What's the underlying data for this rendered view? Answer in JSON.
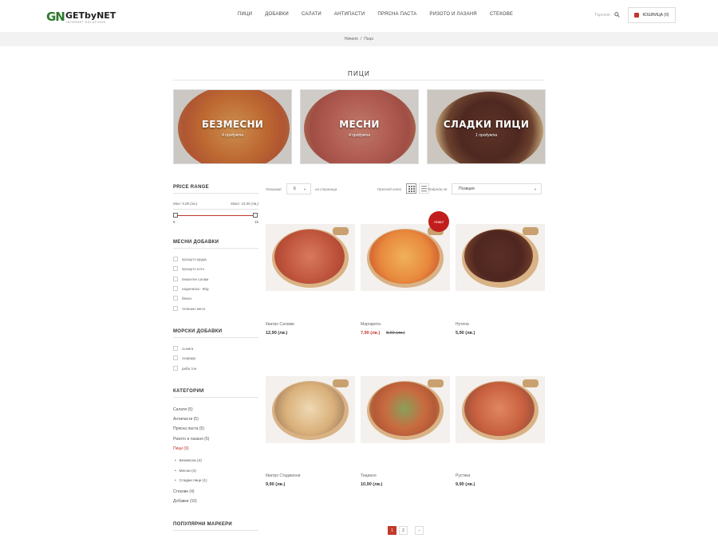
{
  "header": {
    "logo_mark": "GN",
    "logo_text": "GETbyNET",
    "logo_sub": "INTERNET SOLUTIONS",
    "nav": [
      "ПИЦИ",
      "ДОБАВКИ",
      "САЛАТИ",
      "АНТИПАСТИ",
      "ПРЯСНА ПАСТА",
      "РИЗОТО И ЛАЗАНЯ",
      "СТЕКОВЕ"
    ],
    "search_placeholder": "Търсене",
    "cart_label": "КОШНИЦА (0)"
  },
  "breadcrumb": {
    "home": "Начало",
    "sep": "/",
    "current": "Пици"
  },
  "page_title": "ПИЦИ",
  "categories": [
    {
      "title": "БЕЗМЕСНИ",
      "count": "4 продукта"
    },
    {
      "title": "МЕСНИ",
      "count": "4 продукта"
    },
    {
      "title": "СЛАДКИ ПИЦИ",
      "count": "1 продукта"
    }
  ],
  "sidebar": {
    "price_title": "PRICE RANGE",
    "price_min_label": "Мин: 5,00 (лв.)",
    "price_max_label": "Макс: 15,00 (лв.)",
    "slider_min": "5",
    "slider_max": "15",
    "meat_title": "МЕСНИ ДОБАВКИ",
    "meat_items": [
      "прошуто круда",
      "прошуто кото",
      "пикантен салам",
      "надениска - 80g",
      "бекон",
      "телешко месо"
    ],
    "sea_title": "МОРСКИ ДОБАВКИ",
    "sea_items": [
      "сьомга",
      "скариди",
      "риба тон"
    ],
    "cat_title": "КАТЕГОРИИ",
    "cat_items": [
      "Салати (5)",
      "Антипасти (5)",
      "Прясна паста (5)",
      "Ризото и лазаня (5)",
      "Пици (9)"
    ],
    "cat_sub": [
      "Безмесни (4)",
      "Месни (4)",
      "Сладки пици (1)"
    ],
    "cat_items_after": [
      "Стекове (4)",
      "Добавки (10)"
    ],
    "tags_title": "ПОПУЛЯРНИ МАРКЕРИ"
  },
  "toolbar": {
    "show_label": "Показвай",
    "per_page_value": "6",
    "per_page_suffix": "на страница",
    "view_label": "Преглед като",
    "sort_label": "Подреди по",
    "sort_value": "Позиция"
  },
  "products": [
    {
      "name": "Кватро Салами",
      "price": "12,90 (лв.)"
    },
    {
      "name": "Маргарита",
      "price": "7,90 (лв.)",
      "old_price": "8,60 (лв.)",
      "badge": "Ново!"
    },
    {
      "name": "Нутела",
      "price": "5,90 (лв.)"
    },
    {
      "name": "Кватро Стаджиони",
      "price": "9,90 (лв.)"
    },
    {
      "name": "Тициано",
      "price": "10,90 (лв.)"
    },
    {
      "name": "Рустика",
      "price": "9,90 (лв.)"
    }
  ],
  "pagination": {
    "pages": [
      "1",
      "2"
    ],
    "next": "›",
    "current": "1"
  },
  "colors": {
    "accent": "#c0392b",
    "brand_green": "#2d7a2d"
  }
}
